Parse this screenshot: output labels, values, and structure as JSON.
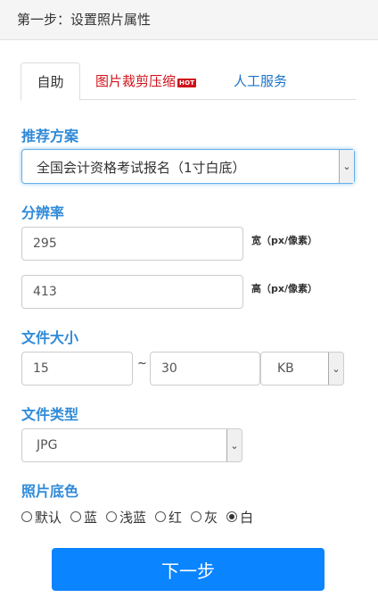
{
  "header": {
    "title": "第一步：设置照片属性"
  },
  "tabs": {
    "self": "自助",
    "crop": "图片裁剪压缩",
    "crop_badge": "HOT",
    "service": "人工服务"
  },
  "recommend": {
    "label": "推荐方案",
    "selected": "全国会计资格考试报名（1寸白底）"
  },
  "resolution": {
    "label": "分辨率",
    "width": "295",
    "width_unit": "宽（px/像素）",
    "height": "413",
    "height_unit": "高（px/像素）"
  },
  "filesize": {
    "label": "文件大小",
    "min": "15",
    "separator": "~",
    "max": "30",
    "unit": "KB"
  },
  "filetype": {
    "label": "文件类型",
    "selected": "JPG"
  },
  "background": {
    "label": "照片底色",
    "options": [
      {
        "label": "默认",
        "checked": false
      },
      {
        "label": "蓝",
        "checked": false
      },
      {
        "label": "浅蓝",
        "checked": false
      },
      {
        "label": "红",
        "checked": false
      },
      {
        "label": "灰",
        "checked": false
      },
      {
        "label": "白",
        "checked": true
      }
    ]
  },
  "actions": {
    "next": "下一步"
  },
  "colors": {
    "accent": "#2f8ad8",
    "button": "#0a84ff",
    "hot": "#d0121b"
  }
}
